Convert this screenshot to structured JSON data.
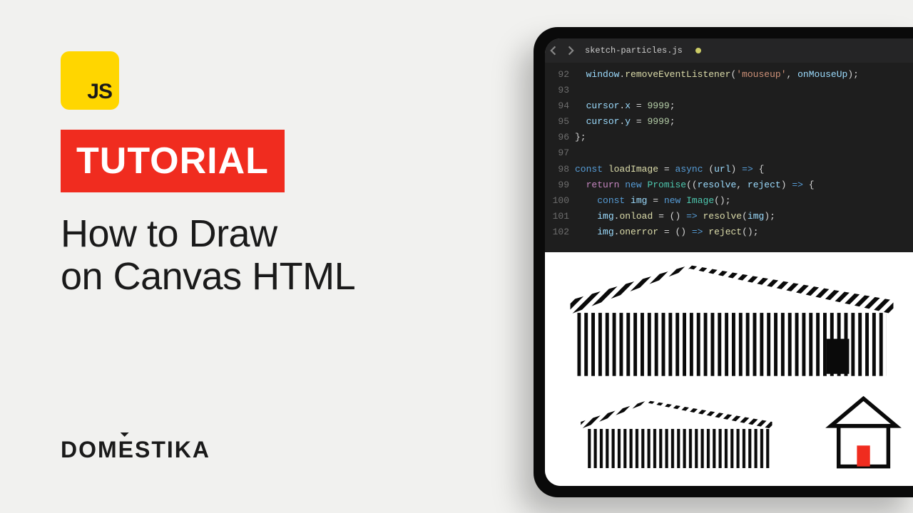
{
  "left": {
    "js_logo_text": "JS",
    "badge": "TUTORIAL",
    "title_line1": "How to Draw",
    "title_line2": "on Canvas HTML"
  },
  "brand": {
    "pre": "DOM",
    "caron": "E",
    "post": "STIKA"
  },
  "editor": {
    "tab_filename": "sketch-particles.js",
    "rows": [
      {
        "n": "92",
        "html": "  <span class='c-var'>window</span><span class='c-pn'>.</span><span class='c-prop'>removeEventListener</span><span class='c-pn'>(</span><span class='c-str'>'mouseup'</span><span class='c-pn'>, </span><span class='c-var'>onMouseUp</span><span class='c-pn'>);</span>"
      },
      {
        "n": "93",
        "html": ""
      },
      {
        "n": "94",
        "html": "  <span class='c-var'>cursor</span><span class='c-pn'>.</span><span class='c-var'>x</span> <span class='c-pn'>=</span> <span class='c-num'>9999</span><span class='c-pn'>;</span>"
      },
      {
        "n": "95",
        "html": "  <span class='c-var'>cursor</span><span class='c-pn'>.</span><span class='c-var'>y</span> <span class='c-pn'>=</span> <span class='c-num'>9999</span><span class='c-pn'>;</span>"
      },
      {
        "n": "96",
        "html": "<span class='c-pn'>};</span>"
      },
      {
        "n": "97",
        "html": ""
      },
      {
        "n": "98",
        "html": "<span class='c-kw2'>const</span> <span class='c-prop'>loadImage</span> <span class='c-pn'>=</span> <span class='c-kw2'>async</span> <span class='c-pn'>(</span><span class='c-par'>url</span><span class='c-pn'>) </span><span class='c-kw2'>=&gt;</span> <span class='c-pn'>{</span>"
      },
      {
        "n": "99",
        "html": "  <span class='c-kw'>return</span> <span class='c-kw2'>new</span> <span class='c-ty'>Promise</span><span class='c-pn'>((</span><span class='c-par'>resolve</span><span class='c-pn'>, </span><span class='c-par'>reject</span><span class='c-pn'>) </span><span class='c-kw2'>=&gt;</span> <span class='c-pn'>{</span>"
      },
      {
        "n": "100",
        "html": "    <span class='c-kw2'>const</span> <span class='c-var'>img</span> <span class='c-pn'>=</span> <span class='c-kw2'>new</span> <span class='c-ty'>Image</span><span class='c-pn'>();</span>"
      },
      {
        "n": "101",
        "html": "    <span class='c-var'>img</span><span class='c-pn'>.</span><span class='c-prop'>onload</span> <span class='c-pn'>= () </span><span class='c-kw2'>=&gt;</span> <span class='c-prop'>resolve</span><span class='c-pn'>(</span><span class='c-var'>img</span><span class='c-pn'>);</span>"
      },
      {
        "n": "102",
        "html": "    <span class='c-var'>img</span><span class='c-pn'>.</span><span class='c-prop'>onerror</span> <span class='c-pn'>= () </span><span class='c-kw2'>=&gt;</span> <span class='c-prop'>reject</span><span class='c-pn'>();</span>"
      }
    ]
  }
}
